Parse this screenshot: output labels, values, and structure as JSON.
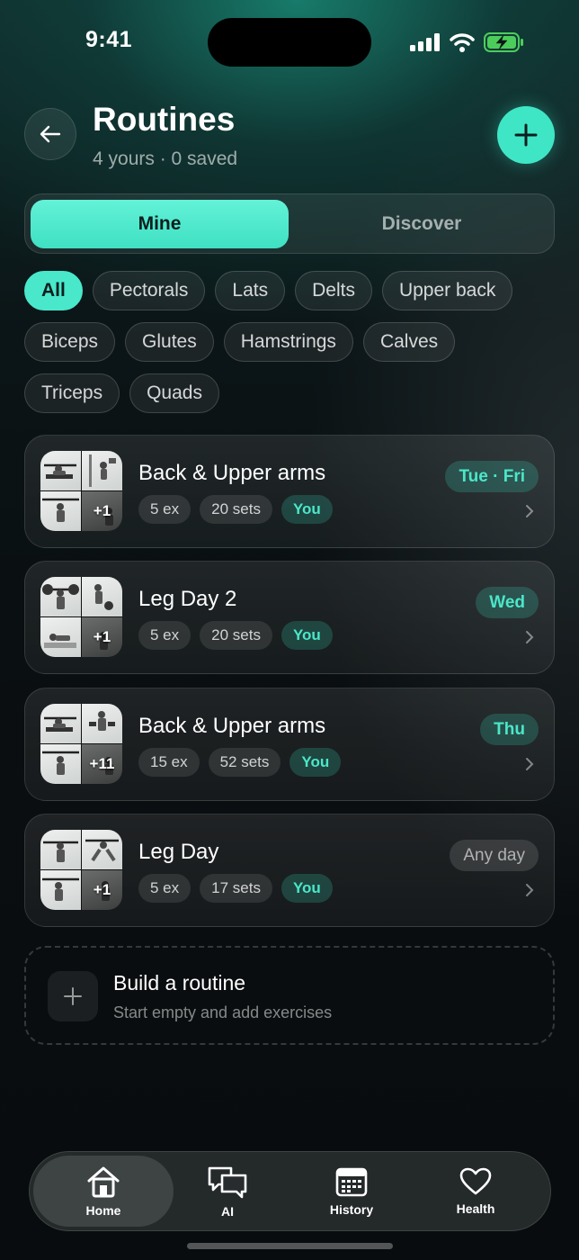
{
  "status_bar": {
    "time": "9:41"
  },
  "header": {
    "title": "Routines",
    "subtitle": "4 yours · 0 saved"
  },
  "segments": {
    "mine": "Mine",
    "discover": "Discover"
  },
  "chips": [
    "All",
    "Pectorals",
    "Lats",
    "Delts",
    "Upper back",
    "Biceps",
    "Glutes",
    "Hamstrings",
    "Calves",
    "Triceps",
    "Quads"
  ],
  "routines": [
    {
      "title": "Back & Upper arms",
      "exercises": "5 ex",
      "sets": "20 sets",
      "owner": "You",
      "day": "Tue · Fri",
      "more": "+1"
    },
    {
      "title": "Leg Day 2",
      "exercises": "5 ex",
      "sets": "20 sets",
      "owner": "You",
      "day": "Wed",
      "more": "+1"
    },
    {
      "title": "Back & Upper arms",
      "exercises": "15 ex",
      "sets": "52 sets",
      "owner": "You",
      "day": "Thu",
      "more": "+11"
    },
    {
      "title": "Leg Day",
      "exercises": "5 ex",
      "sets": "17 sets",
      "owner": "You",
      "day": "Any day",
      "more": "+1"
    }
  ],
  "build": {
    "title": "Build a routine",
    "subtitle": "Start empty and add exercises"
  },
  "tabs": {
    "home": "Home",
    "ai": "AI",
    "history": "History",
    "health": "Health"
  },
  "colors": {
    "accent": "#3ee6c6",
    "background": "#0a0e10"
  },
  "icons": [
    "back-arrow-icon",
    "plus-icon",
    "chevron-right-icon",
    "home-icon",
    "chat-icon",
    "calendar-icon",
    "heart-icon",
    "signal-icon",
    "wifi-icon",
    "battery-icon"
  ]
}
